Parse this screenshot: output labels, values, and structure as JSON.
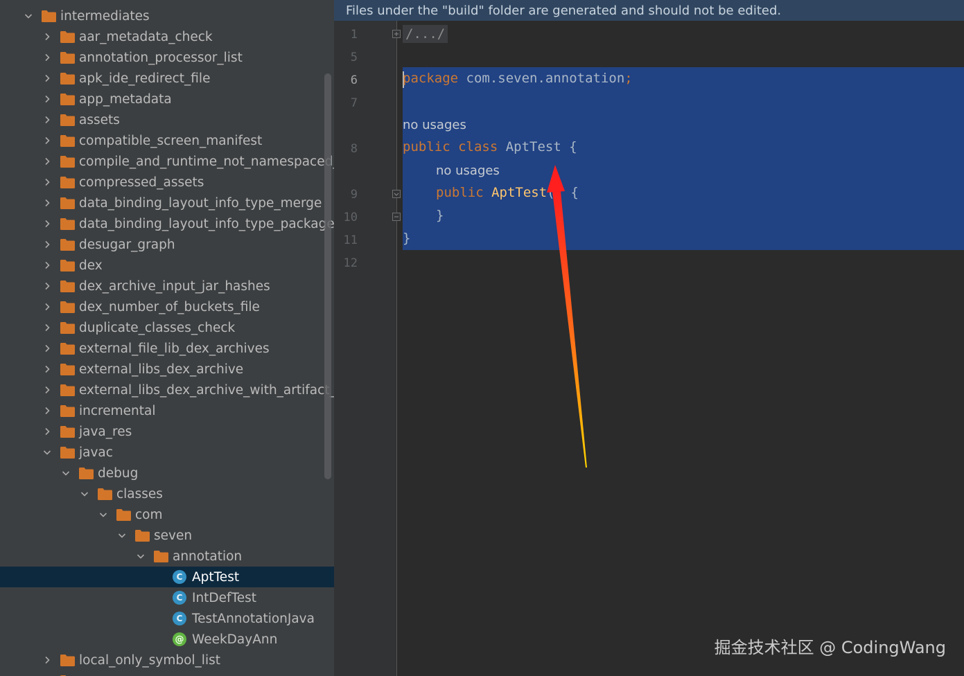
{
  "tree": {
    "rows": [
      {
        "label": "intermediates",
        "icon": "folder",
        "expanded": true,
        "depth": 0
      },
      {
        "label": "aar_metadata_check",
        "icon": "folder",
        "expanded": false,
        "depth": 1
      },
      {
        "label": "annotation_processor_list",
        "icon": "folder",
        "expanded": false,
        "depth": 1
      },
      {
        "label": "apk_ide_redirect_file",
        "icon": "folder",
        "expanded": false,
        "depth": 1
      },
      {
        "label": "app_metadata",
        "icon": "folder",
        "expanded": false,
        "depth": 1
      },
      {
        "label": "assets",
        "icon": "folder",
        "expanded": false,
        "depth": 1
      },
      {
        "label": "compatible_screen_manifest",
        "icon": "folder",
        "expanded": false,
        "depth": 1
      },
      {
        "label": "compile_and_runtime_not_namespaced_r_c",
        "icon": "folder",
        "expanded": false,
        "depth": 1
      },
      {
        "label": "compressed_assets",
        "icon": "folder",
        "expanded": false,
        "depth": 1
      },
      {
        "label": "data_binding_layout_info_type_merge",
        "icon": "folder",
        "expanded": false,
        "depth": 1
      },
      {
        "label": "data_binding_layout_info_type_package",
        "icon": "folder",
        "expanded": false,
        "depth": 1
      },
      {
        "label": "desugar_graph",
        "icon": "folder",
        "expanded": false,
        "depth": 1
      },
      {
        "label": "dex",
        "icon": "folder",
        "expanded": false,
        "depth": 1
      },
      {
        "label": "dex_archive_input_jar_hashes",
        "icon": "folder",
        "expanded": false,
        "depth": 1
      },
      {
        "label": "dex_number_of_buckets_file",
        "icon": "folder",
        "expanded": false,
        "depth": 1
      },
      {
        "label": "duplicate_classes_check",
        "icon": "folder",
        "expanded": false,
        "depth": 1
      },
      {
        "label": "external_file_lib_dex_archives",
        "icon": "folder",
        "expanded": false,
        "depth": 1
      },
      {
        "label": "external_libs_dex_archive",
        "icon": "folder",
        "expanded": false,
        "depth": 1
      },
      {
        "label": "external_libs_dex_archive_with_artifact_tran",
        "icon": "folder",
        "expanded": false,
        "depth": 1
      },
      {
        "label": "incremental",
        "icon": "folder",
        "expanded": false,
        "depth": 1
      },
      {
        "label": "java_res",
        "icon": "folder",
        "expanded": false,
        "depth": 1
      },
      {
        "label": "javac",
        "icon": "folder",
        "expanded": true,
        "depth": 1
      },
      {
        "label": "debug",
        "icon": "folder",
        "expanded": true,
        "depth": 2
      },
      {
        "label": "classes",
        "icon": "folder",
        "expanded": true,
        "depth": 3
      },
      {
        "label": "com",
        "icon": "folder",
        "expanded": true,
        "depth": 4
      },
      {
        "label": "seven",
        "icon": "folder",
        "expanded": true,
        "depth": 5
      },
      {
        "label": "annotation",
        "icon": "folder",
        "expanded": true,
        "depth": 6
      },
      {
        "label": "AptTest",
        "icon": "class",
        "depth": 7,
        "selected": true
      },
      {
        "label": "IntDefTest",
        "icon": "class",
        "depth": 7
      },
      {
        "label": "TestAnnotationJava",
        "icon": "class",
        "depth": 7
      },
      {
        "label": "WeekDayAnn",
        "icon": "annotation",
        "depth": 7
      },
      {
        "label": "local_only_symbol_list",
        "icon": "folder",
        "expanded": false,
        "depth": 1
      },
      {
        "label": "",
        "icon": "folder",
        "expanded": false,
        "depth": 1
      }
    ],
    "class_icon_letter": "C",
    "annotation_icon_letter": "@"
  },
  "editor": {
    "banner": "Files under the \"build\" folder are generated and should not be edited.",
    "line_numbers": [
      "1",
      "5",
      "6",
      "7",
      "8",
      "9",
      "10",
      "11",
      "12"
    ],
    "active_line": "6",
    "folded_comment": "/.../",
    "code": {
      "package_kw": "package",
      "package_name": " com.seven.annotation",
      "package_semi": ";",
      "usage_hint_1": "no usages",
      "class_public": "public",
      "class_kw": " class",
      "class_name": " AptTest {",
      "usage_hint_2": "no usages",
      "ctor_public": "public",
      "ctor_name": " AptTest",
      "ctor_rest": "() {",
      "ctor_close": "}",
      "class_close": "}"
    }
  },
  "watermark": "掘金技术社区 @ CodingWang",
  "colors": {
    "keyword": "#cc7832",
    "function": "#ffc66d",
    "selection": "#214283",
    "folder": "#d4762a",
    "class_icon": "#3592c4",
    "annotation_icon": "#62b543",
    "arrow_start": "#ff1f1f",
    "arrow_end": "#ffd400"
  }
}
